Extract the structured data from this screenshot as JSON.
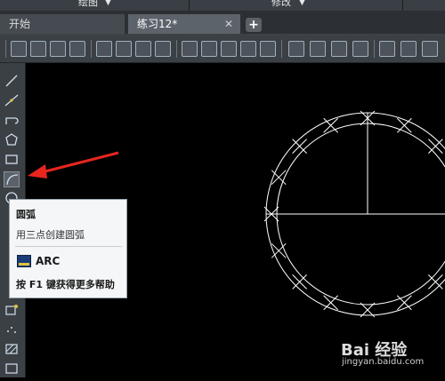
{
  "top_menu": {
    "draw_label": "绘图",
    "modify_label": "修改"
  },
  "tabs": [
    {
      "label": "开始"
    },
    {
      "label": "练习12*"
    }
  ],
  "tab_close_glyph": "✕",
  "tab_add_glyph": "+",
  "left_toolbar": {
    "icons": [
      "line-icon",
      "construction-line-icon",
      "polyline-icon",
      "polygon-icon",
      "rectangle-icon",
      "arc-icon",
      "circle-icon"
    ]
  },
  "tooltip": {
    "title": "圆弧",
    "description": "用三点创建圆弧",
    "command": "ARC",
    "help": "按 F1 键获得更多帮助"
  },
  "watermark": {
    "logo": "Bai 经验",
    "url": "jingyan.baidu.com"
  },
  "colors": {
    "arrow": "#e8261e",
    "drawing": "#ffffff",
    "background": "#000000"
  }
}
